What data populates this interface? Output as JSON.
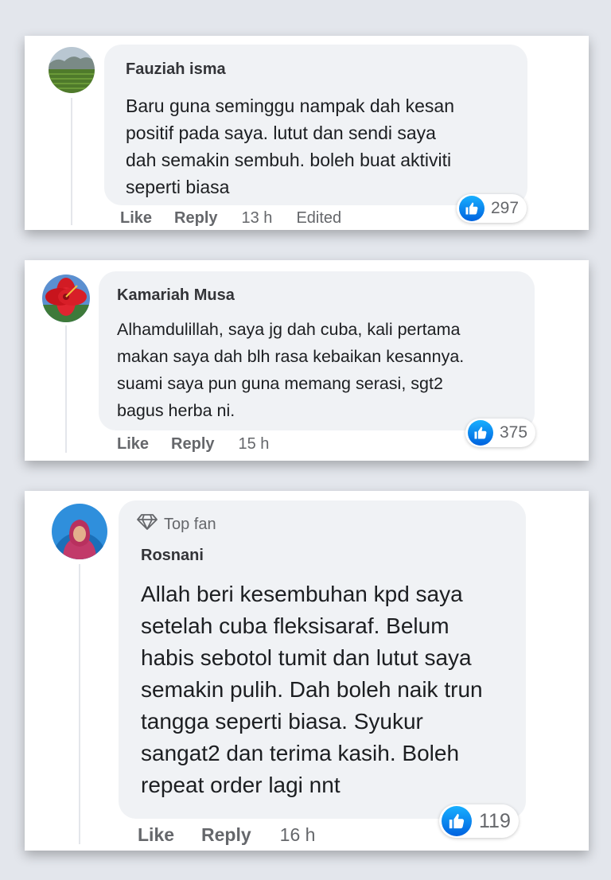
{
  "comments": [
    {
      "author": "Fauziah isma",
      "lines": [
        "Baru guna seminggu nampak dah kesan",
        "positif pada saya. lutut dan sendi saya",
        "dah semakin sembuh. boleh buat aktiviti",
        "seperti biasa"
      ],
      "like_label": "Like",
      "reply_label": "Reply",
      "time": "13 h",
      "edited": "Edited",
      "reaction_count": "297",
      "avatar_icon": "field-landscape-avatar"
    },
    {
      "author": "Kamariah Musa",
      "lines": [
        "Alhamdulillah, saya jg dah cuba, kali pertama",
        "makan saya dah blh rasa kebaikan kesannya.",
        "suami saya pun guna memang serasi, sgt2",
        "bagus herba ni."
      ],
      "like_label": "Like",
      "reply_label": "Reply",
      "time": "15 h",
      "reaction_count": "375",
      "avatar_icon": "red-flower-avatar"
    },
    {
      "badge": "Top fan",
      "badge_icon": "diamond-icon",
      "author": "Rosnani",
      "lines": [
        "Allah beri kesembuhan kpd saya",
        "setelah cuba fleksisaraf. Belum",
        "habis sebotol tumit dan lutut saya",
        "semakin pulih. Dah boleh naik trun",
        "tangga seperti biasa. Syukur",
        "sangat2 dan terima kasih. Boleh",
        "repeat order lagi nnt"
      ],
      "like_label": "Like",
      "reply_label": "Reply",
      "time": "16 h",
      "reaction_count": "119",
      "avatar_icon": "woman-hijab-avatar"
    }
  ],
  "colors": {
    "page_background": "#e3e6ec",
    "bubble": "#f0f2f5",
    "muted_text": "#65676b",
    "like_blue": "#0a7cff"
  }
}
